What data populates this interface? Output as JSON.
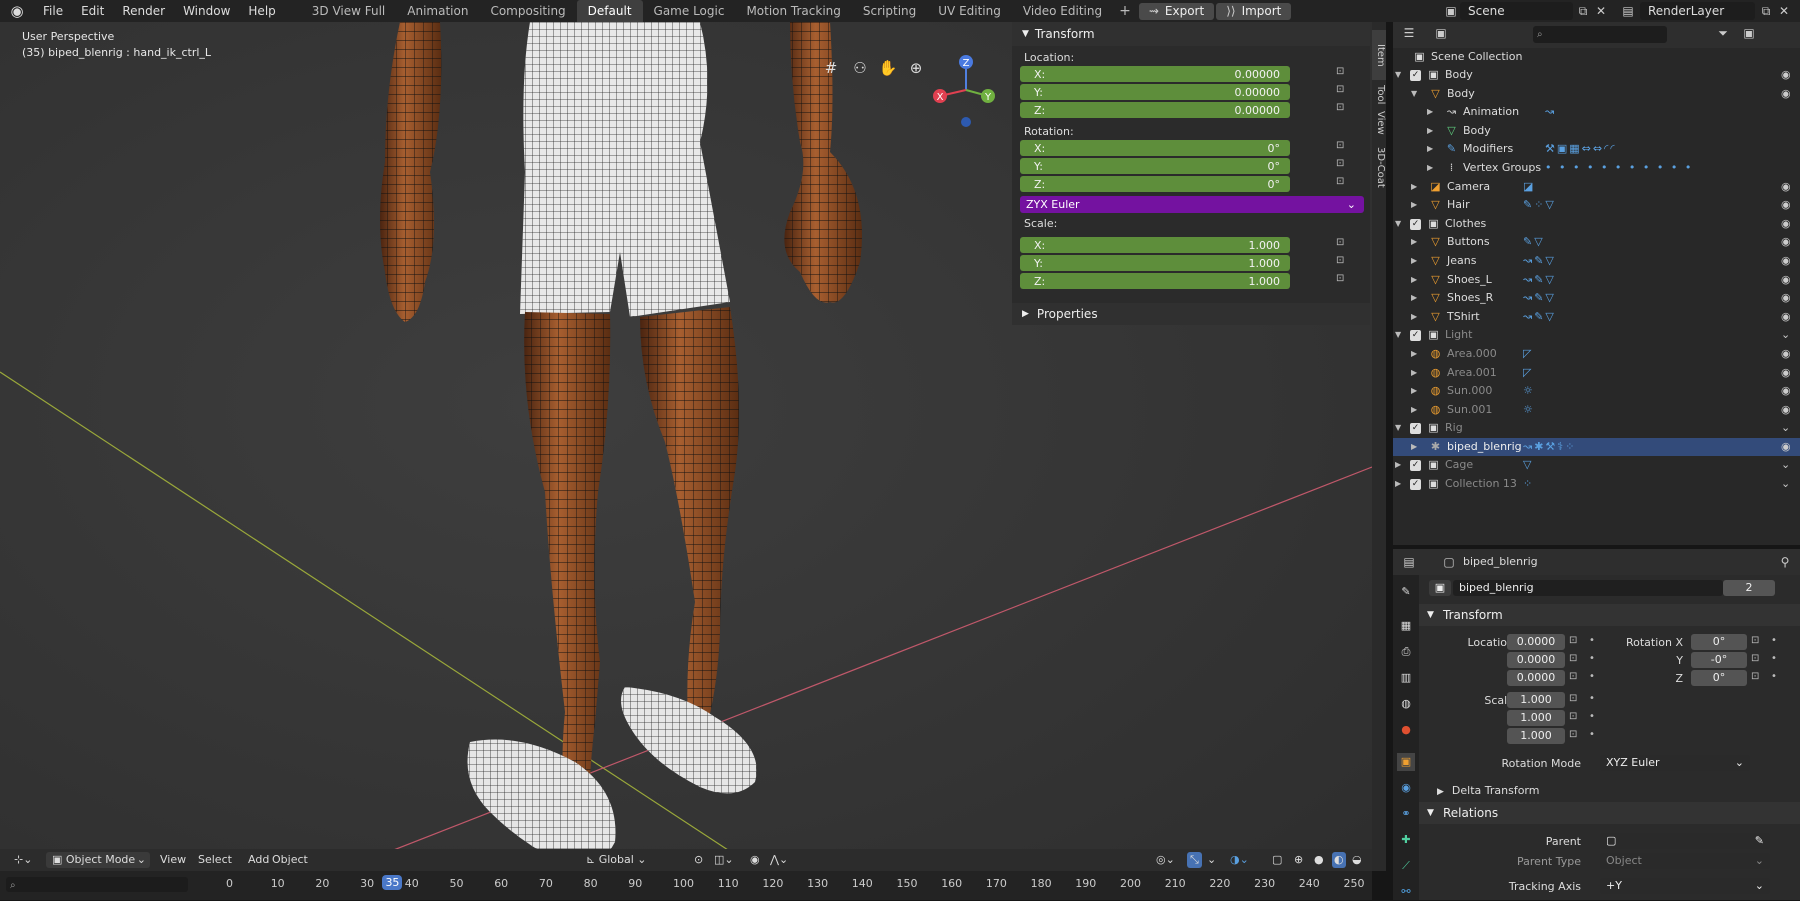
{
  "topbar": {
    "menus": [
      "File",
      "Edit",
      "Render",
      "Window",
      "Help"
    ],
    "workspaces": [
      "3D View Full",
      "Animation",
      "Compositing",
      "Default",
      "Game Logic",
      "Motion Tracking",
      "Scripting",
      "UV Editing",
      "Video Editing"
    ],
    "active_workspace": "Default",
    "export_label": "Export",
    "import_label": "Import",
    "scene": "Scene",
    "render_layer": "RenderLayer"
  },
  "viewport": {
    "perspective": "User Perspective",
    "active_object": "(35) biped_blenrig : hand_ik_ctrl_L"
  },
  "npanel": {
    "transform_title": "Transform",
    "location_label": "Location:",
    "location": [
      {
        "axis": "X:",
        "value": "0.00000"
      },
      {
        "axis": "Y:",
        "value": "0.00000"
      },
      {
        "axis": "Z:",
        "value": "0.00000"
      }
    ],
    "rotation_label": "Rotation:",
    "rotation": [
      {
        "axis": "X:",
        "value": "0°"
      },
      {
        "axis": "Y:",
        "value": "0°"
      },
      {
        "axis": "Z:",
        "value": "0°"
      }
    ],
    "rotation_mode": "ZYX Euler",
    "scale_label": "Scale:",
    "scale": [
      {
        "axis": "X:",
        "value": "1.000"
      },
      {
        "axis": "Y:",
        "value": "1.000"
      },
      {
        "axis": "Z:",
        "value": "1.000"
      }
    ],
    "properties_title": "Properties",
    "tabs": [
      "Item",
      "Tool",
      "View",
      "3D-Coat"
    ]
  },
  "outliner": {
    "root": "Scene Collection",
    "rows": [
      {
        "name": "Body",
        "level": 1,
        "kind": "collection",
        "checkbox": true
      },
      {
        "name": "Body",
        "level": 2,
        "kind": "mesh"
      },
      {
        "name": "Animation",
        "level": 3,
        "kind": "anim"
      },
      {
        "name": "Body",
        "level": 3,
        "kind": "meshdata"
      },
      {
        "name": "Modifiers",
        "level": 3,
        "kind": "wrench"
      },
      {
        "name": "Vertex Groups",
        "level": 3,
        "kind": "vgroup"
      },
      {
        "name": "Camera",
        "level": 2,
        "kind": "camera"
      },
      {
        "name": "Hair",
        "level": 2,
        "kind": "mesh"
      },
      {
        "name": "Clothes",
        "level": 1,
        "kind": "collection",
        "checkbox": true
      },
      {
        "name": "Buttons",
        "level": 2,
        "kind": "mesh"
      },
      {
        "name": "Jeans",
        "level": 2,
        "kind": "mesh"
      },
      {
        "name": "Shoes_L",
        "level": 2,
        "kind": "mesh"
      },
      {
        "name": "Shoes_R",
        "level": 2,
        "kind": "mesh"
      },
      {
        "name": "TShirt",
        "level": 2,
        "kind": "mesh"
      },
      {
        "name": "Light",
        "level": 1,
        "kind": "collection",
        "checkbox": true,
        "dim": true
      },
      {
        "name": "Area.000",
        "level": 2,
        "kind": "light",
        "dim": true
      },
      {
        "name": "Area.001",
        "level": 2,
        "kind": "light",
        "dim": true
      },
      {
        "name": "Sun.000",
        "level": 2,
        "kind": "light",
        "dim": true
      },
      {
        "name": "Sun.001",
        "level": 2,
        "kind": "light",
        "dim": true
      },
      {
        "name": "Rig",
        "level": 1,
        "kind": "collection",
        "checkbox": true,
        "dim": true
      },
      {
        "name": "biped_blenrig",
        "level": 2,
        "kind": "armature",
        "selected": true
      },
      {
        "name": "Cage",
        "level": 1,
        "kind": "collection",
        "checkbox": true,
        "dim": true
      },
      {
        "name": "Collection 13",
        "level": 1,
        "kind": "collection",
        "checkbox": true,
        "dim": true
      }
    ]
  },
  "properties": {
    "object_name": "biped_blenrig",
    "datablock_name": "biped_blenrig",
    "users": "2",
    "transform_title": "Transform",
    "location_x_label": "Location X",
    "y_label": "Y",
    "z_label": "Z",
    "location": [
      "0.0000",
      "0.0000",
      "0.0000"
    ],
    "rotation_x_label": "Rotation X",
    "rotation": [
      "0°",
      "-0°",
      "0°"
    ],
    "scale_x_label": "Scale X",
    "scale": [
      "1.000",
      "1.000",
      "1.000"
    ],
    "rotation_mode_label": "Rotation Mode",
    "rotation_mode": "XYZ Euler",
    "delta_transform": "Delta Transform",
    "relations": "Relations",
    "parent_label": "Parent",
    "parent_type_label": "Parent Type",
    "parent_type": "Object",
    "tracking_axis_label": "Tracking Axis",
    "tracking_axis": "+Y"
  },
  "viewport_header": {
    "mode": "Object Mode",
    "menus": [
      "View",
      "Select",
      "Add",
      "Object"
    ],
    "orientation": "Global"
  },
  "timeline": {
    "current_frame": "35",
    "ticks": [
      "0",
      "10",
      "20",
      "30",
      "40",
      "50",
      "60",
      "70",
      "80",
      "90",
      "100",
      "110",
      "120",
      "130",
      "140",
      "150",
      "160",
      "170",
      "180",
      "190",
      "200",
      "210",
      "220",
      "230",
      "240",
      "250"
    ]
  }
}
